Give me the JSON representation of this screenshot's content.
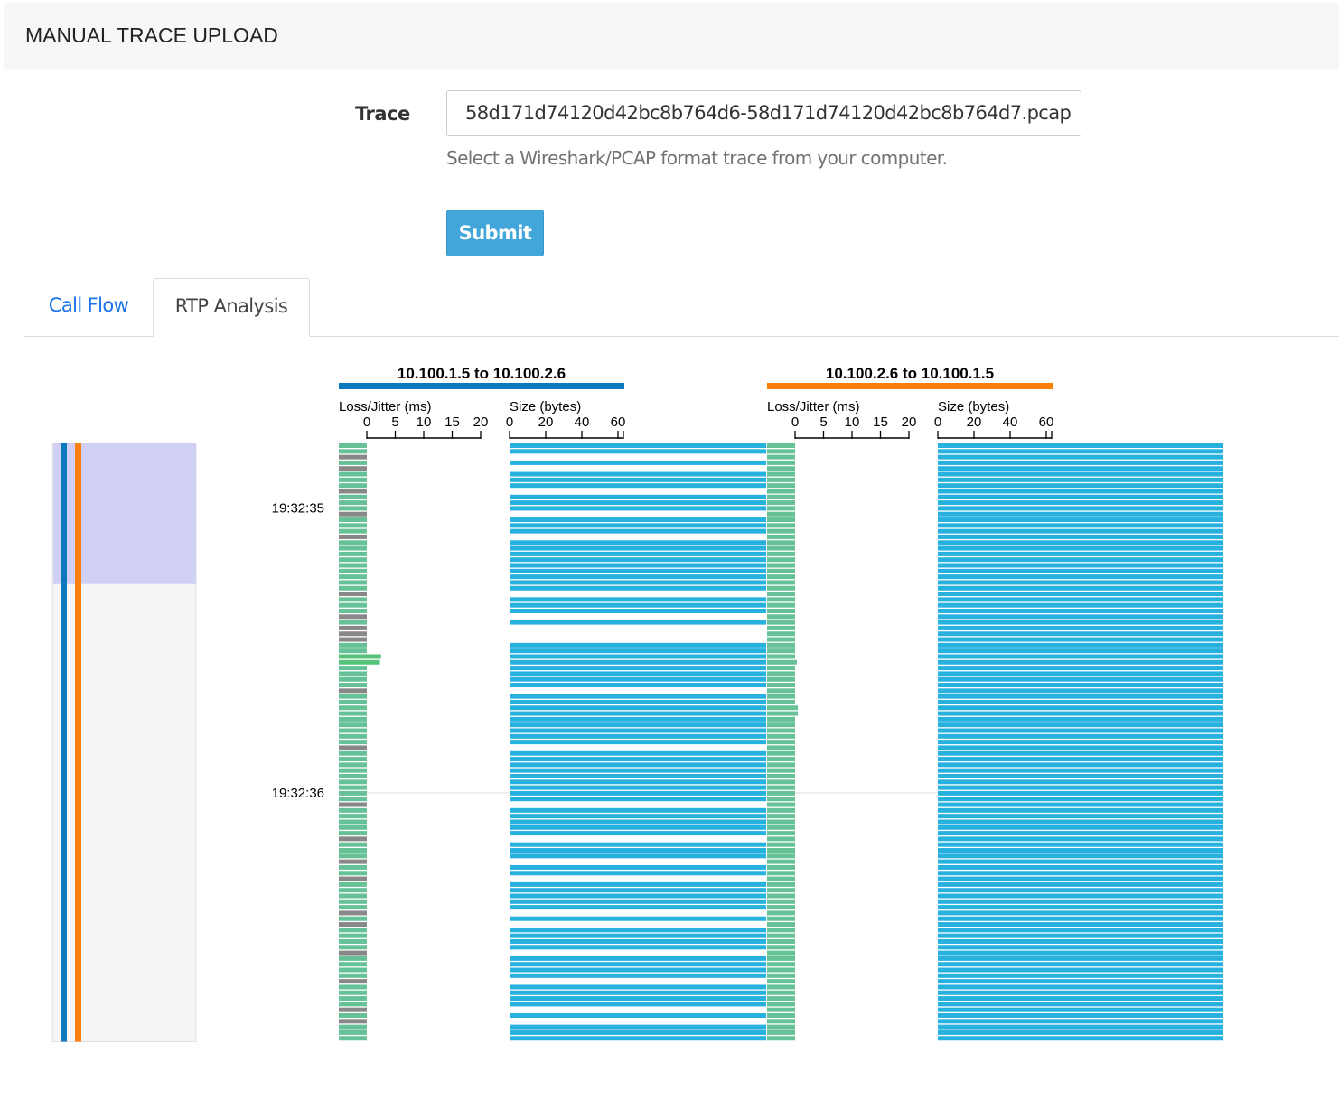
{
  "header": {
    "title": "MANUAL TRACE UPLOAD"
  },
  "form": {
    "trace_label": "Trace",
    "trace_value": "58d171d74120d42bc8b764d6-58d171d74120d42bc8b764d7.pcap",
    "help_text": "Select a Wireshark/PCAP format trace from your computer.",
    "submit_label": "Submit"
  },
  "tabs": [
    {
      "label": "Call Flow",
      "active": false
    },
    {
      "label": "RTP Analysis",
      "active": true
    }
  ],
  "colors": {
    "dir1": "#0a7abf",
    "dir2": "#ff7f0e",
    "jitter": "#66c296",
    "jitter_spike": "#55c27a",
    "lost": "#888888",
    "size": "#27b1df",
    "overview_highlight": "#d0d0f5",
    "overview_bg": "#f5f5f5"
  },
  "chart_data": {
    "type": "bar",
    "time_labels": [
      {
        "label": "19:32:35",
        "row": 11
      },
      {
        "label": "19:32:36",
        "row": 61
      }
    ],
    "rows": 105,
    "loss_axis": {
      "label": "Loss/Jitter (ms)",
      "ticks": [
        0,
        5,
        10,
        15,
        20
      ]
    },
    "size_axis": {
      "label": "Size (bytes)",
      "ticks": [
        0,
        20,
        40,
        60
      ]
    },
    "directions": [
      {
        "title": "10.100.1.5 to 10.100.2.6",
        "color": "dir1",
        "pattern": "nngngnnngnnngnnngnnnnnnnnngnnngnggg",
        "pattern2": "nnnnnnnngnnnnnnnnngnnnnnnnnngnnnnng",
        "pattern3": "nnngnngnnnnngngnnnngnnnngnnnngngnnn",
        "size_bytes": 158,
        "jitter_spikes": [
          {
            "row": 37,
            "ms": 2.5
          },
          {
            "row": 38,
            "ms": 2.3
          }
        ]
      },
      {
        "title": "10.100.2.6 to 10.100.1.5",
        "color": "dir2",
        "pattern": "nnnnnnnnnnnnnnnnnnnnnnnnnnnnnnnnnnn",
        "pattern2": "nnnnnnnnnnnnnnnnnnnnnnnnnnnnnnnnnnn",
        "pattern3": "nnnnnnnnnnnnnnnnnnnnnnnnnnnnnnnnnnn",
        "size_bytes": 158,
        "jitter_spikes": [
          {
            "row": 38,
            "ms": 0.3
          },
          {
            "row": 46,
            "ms": 0.5
          },
          {
            "row": 47,
            "ms": 0.5
          }
        ]
      }
    ],
    "overview": {
      "highlight_fraction": 0.235
    }
  }
}
